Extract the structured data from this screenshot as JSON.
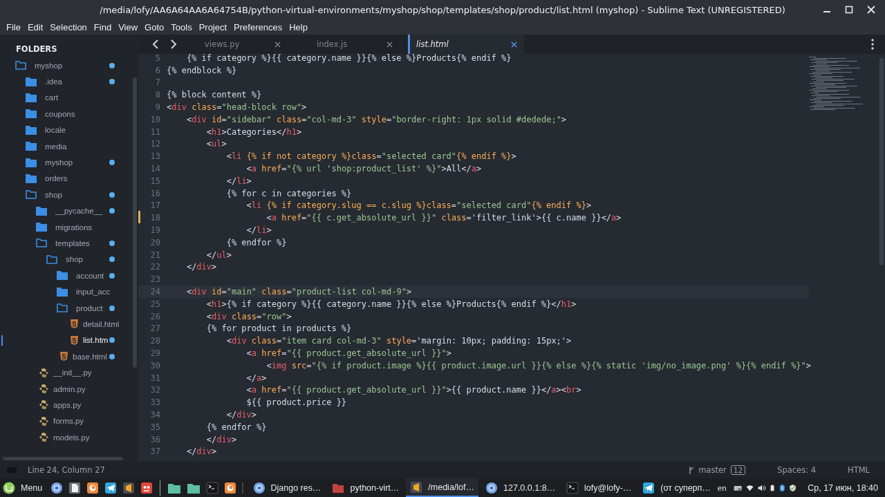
{
  "window": {
    "title": "/media/lofy/AA6A64AA6A64754B/python-virtual-environments/myshop/shop/templates/shop/product/list.html (myshop) - Sublime Text (UNREGISTERED)"
  },
  "menu": [
    "File",
    "Edit",
    "Selection",
    "Find",
    "View",
    "Goto",
    "Tools",
    "Project",
    "Preferences",
    "Help"
  ],
  "sidebar": {
    "title": "FOLDERS",
    "items": [
      {
        "name": "myshop",
        "kind": "folder",
        "expanded": true,
        "modified": true,
        "selected": false,
        "children": [
          {
            "name": ".idea",
            "kind": "folder",
            "expanded": false,
            "modified": true,
            "selected": false
          },
          {
            "name": "cart",
            "kind": "folder",
            "expanded": false,
            "modified": false,
            "selected": false
          },
          {
            "name": "coupons",
            "kind": "folder",
            "expanded": false,
            "modified": false,
            "selected": false
          },
          {
            "name": "locale",
            "kind": "folder",
            "expanded": false,
            "modified": false,
            "selected": false
          },
          {
            "name": "media",
            "kind": "folder",
            "expanded": false,
            "modified": false,
            "selected": false
          },
          {
            "name": "myshop",
            "kind": "folder",
            "expanded": false,
            "modified": true,
            "selected": false
          },
          {
            "name": "orders",
            "kind": "folder",
            "expanded": false,
            "modified": false,
            "selected": false
          },
          {
            "name": "shop",
            "kind": "folder",
            "expanded": true,
            "modified": true,
            "selected": false,
            "children": [
              {
                "name": "__pycache__",
                "kind": "folder",
                "expanded": false,
                "modified": true,
                "selected": false
              },
              {
                "name": "migrations",
                "kind": "folder",
                "expanded": false,
                "modified": false,
                "selected": false
              },
              {
                "name": "templates",
                "kind": "folder",
                "expanded": true,
                "modified": true,
                "selected": false,
                "children": [
                  {
                    "name": "shop",
                    "kind": "folder",
                    "expanded": true,
                    "modified": true,
                    "selected": false,
                    "children": [
                      {
                        "name": "account",
                        "kind": "folder",
                        "expanded": false,
                        "modified": true,
                        "selected": false
                      },
                      {
                        "name": "input_acc",
                        "kind": "folder",
                        "expanded": false,
                        "modified": false,
                        "selected": false
                      },
                      {
                        "name": "product",
                        "kind": "folder",
                        "expanded": true,
                        "modified": true,
                        "selected": false,
                        "children": [
                          {
                            "name": "detail.html",
                            "kind": "html",
                            "modified": false,
                            "selected": false
                          },
                          {
                            "name": "list.htm",
                            "kind": "html",
                            "modified": true,
                            "selected": true
                          }
                        ]
                      },
                      {
                        "name": "base.html",
                        "kind": "html",
                        "modified": true,
                        "selected": false
                      }
                    ]
                  }
                ]
              },
              {
                "name": "__init__.py",
                "kind": "python",
                "modified": false,
                "selected": false
              },
              {
                "name": "admin.py",
                "kind": "python",
                "modified": false,
                "selected": false
              },
              {
                "name": "apps.py",
                "kind": "python",
                "modified": false,
                "selected": false
              },
              {
                "name": "forms.py",
                "kind": "python",
                "modified": false,
                "selected": false
              },
              {
                "name": "models.py",
                "kind": "python",
                "modified": false,
                "selected": false
              }
            ]
          }
        ]
      }
    ]
  },
  "tabs": [
    {
      "label": "views.py",
      "selected": false
    },
    {
      "label": "index.js",
      "selected": false
    },
    {
      "label": "list.html",
      "selected": true
    }
  ],
  "code": [
    {
      "n": "5",
      "text": "    {% if category %}{{ category.name }}{% else %}Products{% endif %}",
      "current": false,
      "modified": false
    },
    {
      "n": "6",
      "text": "{% endblock %}",
      "current": false,
      "modified": false
    },
    {
      "n": "7",
      "current": false,
      "modified": false
    },
    {
      "n": "8",
      "text": "{% block content %}",
      "current": false,
      "modified": false
    },
    {
      "n": "9",
      "text": "<div class=\"head-block row\">",
      "current": false,
      "modified": false
    },
    {
      "n": "10",
      "text": "    <div id=\"sidebar\" class=\"col-md-3\" style=\"border-right: 1px solid #dedede;\">",
      "current": false,
      "modified": false
    },
    {
      "n": "11",
      "text": "        <h1>Categories</h1>",
      "current": false,
      "modified": false
    },
    {
      "n": "12",
      "text": "        <ul>",
      "current": false,
      "modified": false
    },
    {
      "n": "13",
      "text": "            <li {% if not category %}class=\"selected card\"{% endif %}>",
      "current": false,
      "modified": false
    },
    {
      "n": "14",
      "text": "                <a href=\"{% url 'shop:product_list' %}\">All</a>",
      "current": false,
      "modified": false
    },
    {
      "n": "15",
      "text": "            </li>",
      "current": false,
      "modified": false
    },
    {
      "n": "16",
      "text": "            {% for c in categories %}",
      "current": false,
      "modified": false
    },
    {
      "n": "17",
      "text": "                <li {% if category.slug == c.slug %}class=\"selected card\"{% endif %}>",
      "current": false,
      "modified": false
    },
    {
      "n": "18",
      "text": "                    <a href=\"{{ c.get_absolute_url }}\" class='filter_link'>{{ c.name }}</a>",
      "current": false,
      "modified": true
    },
    {
      "n": "19",
      "text": "                </li>",
      "current": false,
      "modified": false
    },
    {
      "n": "20",
      "text": "            {% endfor %}",
      "current": false,
      "modified": false
    },
    {
      "n": "21",
      "text": "        </ul>",
      "current": false,
      "modified": false
    },
    {
      "n": "22",
      "text": "    </div>",
      "current": false,
      "modified": false
    },
    {
      "n": "23",
      "current": false,
      "modified": false
    },
    {
      "n": "24",
      "text": "    <div id=\"main\" class=\"product-list col-md-9\">",
      "current": true,
      "modified": false
    },
    {
      "n": "25",
      "text": "        <h1>{% if category %}{{ category.name }}{% else %}Products{% endif %}</h1>",
      "current": false,
      "modified": false
    },
    {
      "n": "26",
      "text": "        <div class=\"row\">",
      "current": false,
      "modified": false
    },
    {
      "n": "27",
      "text": "        {% for product in products %}",
      "current": false,
      "modified": false
    },
    {
      "n": "28",
      "text": "            <div class=\"item card col-md-3\" style='margin: 10px; padding: 15px;'>",
      "current": false,
      "modified": false
    },
    {
      "n": "29",
      "text": "                <a href=\"{{ product.get_absolute_url }}\">",
      "current": false,
      "modified": false
    },
    {
      "n": "30",
      "text": "                    <img src=\"{% if product.image %}{{ product.image.url }}{% else %}{% static 'img/no_image.png' %}{% endif %}\">",
      "current": false,
      "modified": false
    },
    {
      "n": "31",
      "text": "                </a>",
      "current": false,
      "modified": false
    },
    {
      "n": "32",
      "text": "                <a href=\"{{ product.get_absolute_url }}\">{{ product.name }}</a><br>",
      "current": false,
      "modified": false
    },
    {
      "n": "33",
      "text": "                ${{ product.price }}",
      "current": false,
      "modified": false
    },
    {
      "n": "34",
      "text": "            </div>",
      "current": false,
      "modified": false
    },
    {
      "n": "35",
      "text": "        {% endfor %}",
      "current": false,
      "modified": false
    },
    {
      "n": "36",
      "text": "        </div>",
      "current": false,
      "modified": false
    },
    {
      "n": "37",
      "text": "    </div>",
      "current": false,
      "modified": false
    }
  ],
  "status_bar": {
    "position": "Line 24, Column 27",
    "branch": "master",
    "changes": "12",
    "indent": "Spaces: 4",
    "syntax": "HTML"
  },
  "taskbar": {
    "menu": "Menu",
    "launchers": [
      {
        "kind": "browser"
      },
      {
        "kind": "document"
      },
      {
        "kind": "firefox"
      },
      {
        "kind": "telegram"
      },
      {
        "kind": "sublime"
      },
      {
        "kind": "app"
      },
      {
        "kind": "files"
      },
      {
        "kind": "files"
      },
      {
        "kind": "terminal"
      },
      {
        "kind": "firefox"
      }
    ],
    "windows": [
      {
        "label": "Django res…",
        "kind": "browser",
        "selected": false
      },
      {
        "label": "python-virt…",
        "kind": "folder",
        "selected": false
      },
      {
        "label": "/media/lof…",
        "kind": "sublime",
        "selected": true
      },
      {
        "label": "127.0.0.1:8…",
        "kind": "browser",
        "selected": false
      },
      {
        "label": "lofy@lofy-…",
        "kind": "terminal",
        "selected": false
      },
      {
        "label": "(от суперп…",
        "kind": "telegram",
        "selected": false
      }
    ],
    "keyboard": "en",
    "clock": "Ср, 17 июн, 18:40"
  }
}
